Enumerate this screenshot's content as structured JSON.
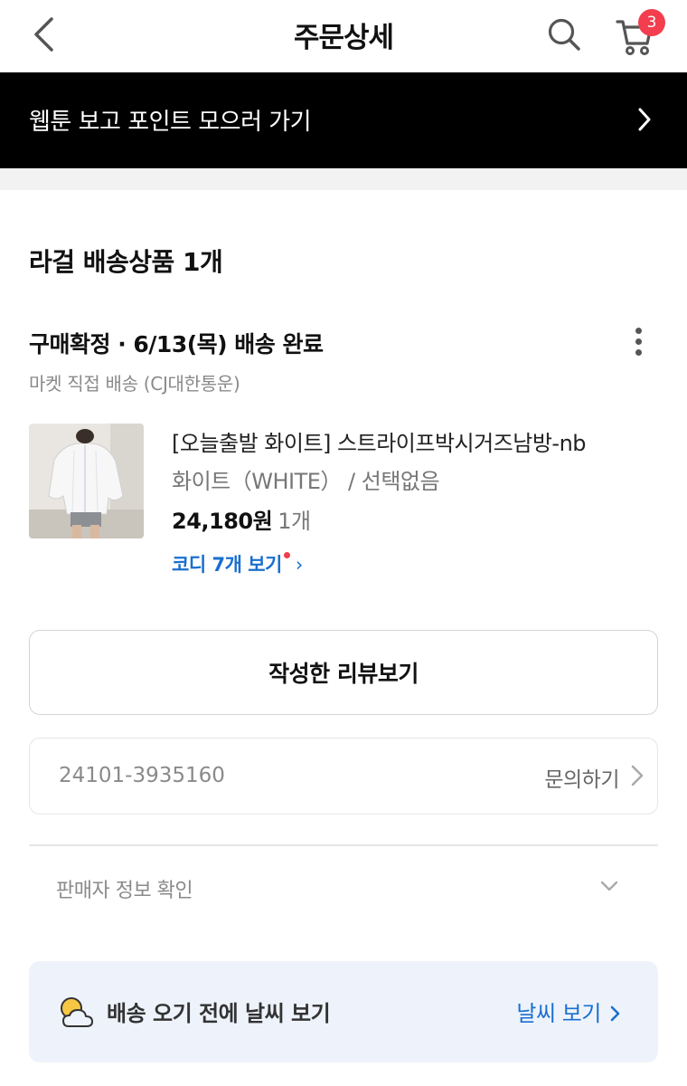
{
  "header": {
    "title": "주문상세",
    "cart_count": "3"
  },
  "banner": {
    "text": "웹툰 보고 포인트 모으러 가기"
  },
  "section": {
    "title": "라걸 배송상품 1개"
  },
  "order": {
    "status": "구매확정 · 6/13(목) 배송 완료",
    "shipping_info": "마켓 직접 배송 (CJ대한통운)",
    "product": {
      "name": "[오늘출발 화이트] 스트라이프박시거즈남방-nb",
      "option": "화이트（WHITE） / 선택없음",
      "price": "24,180원",
      "quantity": "1개"
    },
    "codi_link": "코디 7개 보기",
    "codi_arrow": "›",
    "review_button": "작성한 리뷰보기",
    "order_number": "24101-3935160",
    "inquiry_link": "문의하기",
    "seller_info": "판매자 정보 확인"
  },
  "weather": {
    "text": "배송 오기 전에 날씨 보기",
    "link": "날씨 보기"
  },
  "colors": {
    "accent_blue": "#1a6fcf",
    "badge_red": "#f23e4e",
    "banner_bg": "#000000",
    "weather_bg": "#eef3fb"
  },
  "icons": [
    "back-arrow-icon",
    "search-icon",
    "cart-icon",
    "chevron-right-icon",
    "more-vertical-icon",
    "chevron-down-icon",
    "weather-icon"
  ]
}
